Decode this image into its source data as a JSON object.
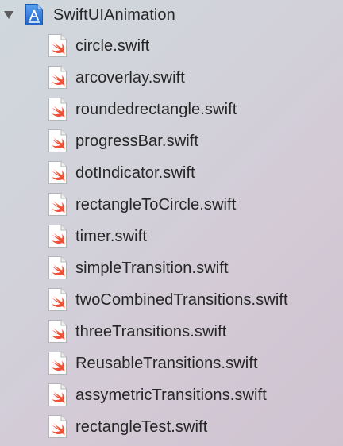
{
  "navigator": {
    "project": {
      "name": "SwiftUIAnimation",
      "expanded": true,
      "icon": "xcode-project-icon"
    },
    "files": [
      {
        "name": "circle.swift",
        "icon": "swift-file-icon"
      },
      {
        "name": "arcoverlay.swift",
        "icon": "swift-file-icon"
      },
      {
        "name": "roundedrectangle.swift",
        "icon": "swift-file-icon"
      },
      {
        "name": "progressBar.swift",
        "icon": "swift-file-icon"
      },
      {
        "name": "dotIndicator.swift",
        "icon": "swift-file-icon"
      },
      {
        "name": "rectangleToCircle.swift",
        "icon": "swift-file-icon"
      },
      {
        "name": "timer.swift",
        "icon": "swift-file-icon"
      },
      {
        "name": "simpleTransition.swift",
        "icon": "swift-file-icon"
      },
      {
        "name": "twoCombinedTransitions.swift",
        "icon": "swift-file-icon"
      },
      {
        "name": "threeTransitions.swift",
        "icon": "swift-file-icon"
      },
      {
        "name": "ReusableTransitions.swift",
        "icon": "swift-file-icon"
      },
      {
        "name": "assymetricTransitions.swift",
        "icon": "swift-file-icon"
      },
      {
        "name": "rectangleTest.swift",
        "icon": "swift-file-icon"
      }
    ]
  },
  "colors": {
    "swift_orange": "#f05138",
    "project_blue": "#2f7ce0",
    "text": "#262626"
  }
}
